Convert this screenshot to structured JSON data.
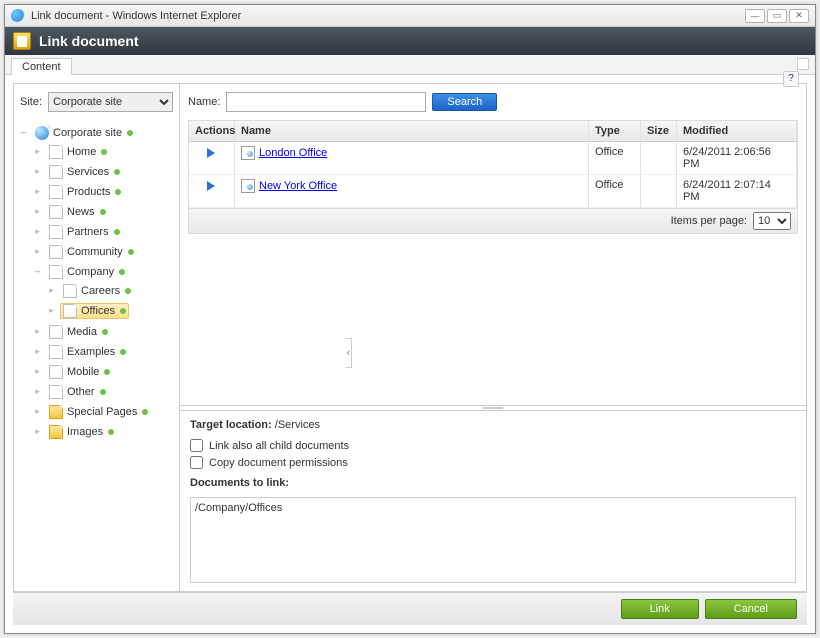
{
  "window_title": "Link document - Windows Internet Explorer",
  "header_title": "Link document",
  "tab": "Content",
  "site_label": "Site:",
  "site_value": "Corporate site",
  "tree_root": "Corporate site",
  "tree": [
    {
      "label": "Home"
    },
    {
      "label": "Services"
    },
    {
      "label": "Products"
    },
    {
      "label": "News"
    },
    {
      "label": "Partners"
    },
    {
      "label": "Community"
    },
    {
      "label": "Company",
      "expanded": true,
      "children": [
        {
          "label": "Careers"
        },
        {
          "label": "Offices",
          "selected": true
        }
      ]
    },
    {
      "label": "Media"
    },
    {
      "label": "Examples"
    },
    {
      "label": "Mobile"
    },
    {
      "label": "Other"
    },
    {
      "label": "Special Pages",
      "folder": true
    },
    {
      "label": "Images",
      "folder": true
    }
  ],
  "search": {
    "label": "Name:",
    "value": "",
    "button": "Search"
  },
  "columns": {
    "actions": "Actions",
    "name": "Name",
    "type": "Type",
    "size": "Size",
    "modified": "Modified"
  },
  "rows": [
    {
      "name": "London Office",
      "type": "Office",
      "size": "",
      "modified": "6/24/2011 2:06:56 PM"
    },
    {
      "name": "New York Office",
      "type": "Office",
      "size": "",
      "modified": "6/24/2011 2:07:14 PM"
    }
  ],
  "items_per_page_label": "Items per page:",
  "items_per_page_value": "10",
  "target_location_label": "Target location:",
  "target_location_value": "/Services",
  "opt_link_children": "Link also all child documents",
  "opt_copy_perms": "Copy document permissions",
  "docs_to_link_label": "Documents to link:",
  "docs_to_link_value": "/Company/Offices",
  "link_btn": "Link",
  "cancel_btn": "Cancel"
}
